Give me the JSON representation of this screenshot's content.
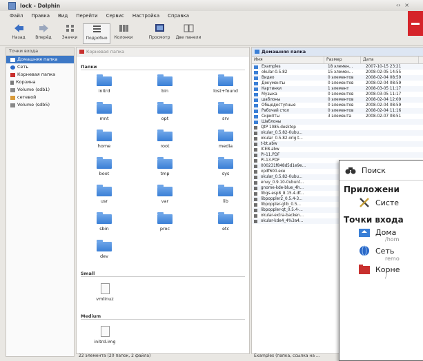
{
  "window": {
    "title": "lock - Dolphin",
    "controls": [
      "‹›",
      "×"
    ]
  },
  "menubar": [
    "Файл",
    "Правка",
    "Вид",
    "Перейти",
    "Сервис",
    "Настройка",
    "Справка"
  ],
  "toolbar": [
    {
      "label": "Назад",
      "icon": "back-arrow-icon"
    },
    {
      "label": "Вперёд",
      "icon": "forward-arrow-icon"
    },
    {
      "label": "Значки",
      "icon": "icons-view-icon"
    },
    {
      "label": "Подробно",
      "icon": "details-view-icon"
    },
    {
      "label": "Колонки",
      "icon": "columns-view-icon"
    },
    {
      "label": "Просмотр",
      "icon": "preview-icon"
    },
    {
      "label": "Две панели",
      "icon": "split-icon"
    }
  ],
  "places": {
    "header": "Точки входа",
    "items": [
      {
        "label": "Домашняя папка",
        "selected": true,
        "color": "#ffffff"
      },
      {
        "label": "Сеть",
        "selected": false,
        "color": "#2a68c8"
      },
      {
        "label": "Корневая папка",
        "selected": false,
        "color": "#c8302e"
      },
      {
        "label": "Корзина",
        "selected": false,
        "color": "#7a7a7a"
      },
      {
        "label": "Volume (sdb1)",
        "selected": false,
        "color": "#888888"
      },
      {
        "label": "сетевой",
        "selected": false,
        "color": "#d89a3a"
      },
      {
        "label": "Volume (sdb5)",
        "selected": false,
        "color": "#888888"
      }
    ]
  },
  "left_pane": {
    "location": "Корневая папка",
    "group_folders": "Папки",
    "folders": [
      "initrd",
      "bin",
      "lost+found",
      "mnt",
      "opt",
      "srv",
      "home",
      "root",
      "media",
      "boot",
      "tmp",
      "sys",
      "usr",
      "var",
      "lib",
      "sbin",
      "proc",
      "etc",
      "dev"
    ],
    "group_small": "Small",
    "small_file": "vmlinuz",
    "group_medium": "Medium",
    "medium_file": "initrd.img",
    "status": "22 элемента (20 папок, 2 файла)"
  },
  "right_pane": {
    "location": "Домашняя папка",
    "columns": [
      "Имя",
      "Размер",
      "Дата"
    ],
    "rows": [
      {
        "name": "Examples",
        "size": "18 элемен...",
        "date": "2007-10-15 23:21",
        "folder": true
      },
      {
        "name": "okular-0.5.82",
        "size": "15 элемен...",
        "date": "2008-02-05 14:55",
        "folder": true
      },
      {
        "name": "Видео",
        "size": "0 элементов",
        "date": "2008-02-04 08:59",
        "folder": true
      },
      {
        "name": "Документы",
        "size": "0 элементов",
        "date": "2008-02-04 08:59",
        "folder": true
      },
      {
        "name": "Картинки",
        "size": "1 элемент",
        "date": "2008-03-05 11:17",
        "folder": true
      },
      {
        "name": "Музыка",
        "size": "0 элементов",
        "date": "2008-03-05 11:17",
        "folder": true
      },
      {
        "name": "шаблоны",
        "size": "0 элементов",
        "date": "2008-02-04 12:09",
        "folder": true
      },
      {
        "name": "Общедоступные",
        "size": "0 элементов",
        "date": "2008-02-04 08:59",
        "folder": true
      },
      {
        "name": "Рабочий стол",
        "size": "0 элементов",
        "date": "2008-02-04 11:16",
        "folder": true
      },
      {
        "name": "Скрипты",
        "size": "3 элемента",
        "date": "2008-02-07 08:51",
        "folder": true
      },
      {
        "name": "Шаблоны",
        "size": "",
        "date": "",
        "folder": true
      },
      {
        "name": "QtP 1085.desktop",
        "size": "",
        "date": "",
        "folder": false
      },
      {
        "name": "okular_0.5.82-0ubu...",
        "size": "",
        "date": "",
        "folder": false
      },
      {
        "name": "okular_0.5.82.orig.t...",
        "size": "",
        "date": "",
        "folder": false
      },
      {
        "name": "t-bt.abw",
        "size": "",
        "date": "",
        "folder": false
      },
      {
        "name": "ICEB.abw",
        "size": "",
        "date": "",
        "folder": false
      },
      {
        "name": "PI-11.PDF",
        "size": "",
        "date": "",
        "folder": false
      },
      {
        "name": "PI-13.PDF",
        "size": "",
        "date": "",
        "folder": false
      },
      {
        "name": "000231f848d5d1e9e...",
        "size": "",
        "date": "",
        "folder": false
      },
      {
        "name": "xpdf600.exe",
        "size": "",
        "date": "",
        "folder": false
      },
      {
        "name": "okular_0.5.82-0ubu...",
        "size": "",
        "date": "",
        "folder": false
      },
      {
        "name": "envy_0.9.10-0ubunt...",
        "size": "",
        "date": "",
        "folder": false
      },
      {
        "name": "gnome-kde-blue_4h...",
        "size": "",
        "date": "",
        "folder": false
      },
      {
        "name": "libgs-esp8_8.15.4.df...",
        "size": "",
        "date": "",
        "folder": false
      },
      {
        "name": "libpoppler2_0.5.4-3...",
        "size": "",
        "date": "",
        "folder": false
      },
      {
        "name": "libpoppler-glib_0.5...",
        "size": "",
        "date": "",
        "folder": false
      },
      {
        "name": "libpoppler-qt_0.5.4-...",
        "size": "",
        "date": "",
        "folder": false
      },
      {
        "name": "okular-extra-backen...",
        "size": "",
        "date": "",
        "folder": false
      },
      {
        "name": "okular-kde4_4%3a4...",
        "size": "",
        "date": "",
        "folder": false
      }
    ],
    "status": "Examples (папка, ссылка на ..."
  },
  "popup": {
    "search": "Поиск",
    "section1": "Приложени",
    "app_item": "Систе",
    "section2": "Точки входа",
    "home": "Дома",
    "home_sub": "/hom",
    "net": "Сеть",
    "net_sub": "remo",
    "root": "Корне",
    "root_sub": "/"
  }
}
